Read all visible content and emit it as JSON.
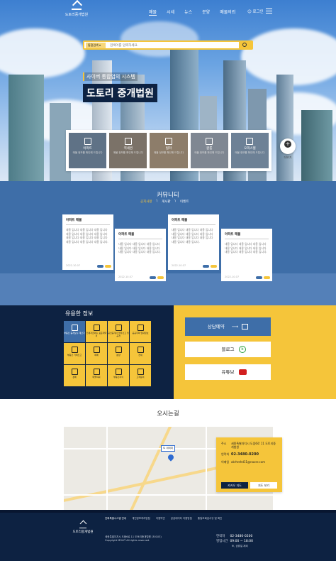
{
  "header": {
    "logo_text": "도토리중개법원",
    "menu": [
      "매물",
      "시세",
      "뉴스",
      "분양",
      "매물의뢰"
    ],
    "active_menu": "매물",
    "login": "로그인"
  },
  "search": {
    "select_label": "통합검색",
    "placeholder": "검색어를 입력하세요."
  },
  "hero": {
    "subtitle": "사이버 통합업의 시스템",
    "title": "도토리 중개법원"
  },
  "categories": [
    {
      "label": "아파트",
      "sub": "매물 정보를 확인해 드립니다"
    },
    {
      "label": "역세권",
      "sub": "매물 정보를 확인해 드립니다"
    },
    {
      "label": "빌라",
      "sub": "매물 정보를 확인해 드립니다"
    },
    {
      "label": "원룸",
      "sub": "매물 정보를 확인해 드립니다"
    },
    {
      "label": "오피스텔",
      "sub": "매물 정보를 확인해 드립니다"
    }
  ],
  "more_label": "더보기",
  "community": {
    "title": "커뮤니티",
    "tabs": [
      "공지사항",
      "게시판",
      "이벤트"
    ],
    "cards": [
      {
        "title": "아파트 매물",
        "body": "내용 입니다 내용 입니다 내용 입니다 내용 입니다 내용 입니다 내용 입니다 내용 입니다 내용 입니다 내용 입니다 내용 입니다 내용 입니다 내용 입니다.",
        "date": "2022.10.07"
      },
      {
        "title": "아파트 매물",
        "body": "내용 입니다 내용 입니다 내용 입니다 내용 입니다 내용 입니다 내용 입니다 내용 입니다 내용 입니다 내용 입니다.",
        "date": "2022.10.07"
      },
      {
        "title": "아파트 매물",
        "body": "내용 입니다 내용 입니다 내용 입니다 내용 입니다 내용 입니다 내용 입니다 내용 입니다 내용 입니다 내용 입니다 내용 입니다 내용 입니다.",
        "date": "2022.10.07"
      },
      {
        "title": "아파트 매물",
        "body": "내용 입니다 내용 입니다 내용 입니다 내용 입니다 내용 입니다 내용 입니다 내용 입니다 내용 입니다 내용 입니다.",
        "date": "2022.10.07"
      }
    ]
  },
  "info": {
    "title": "유용한 정보",
    "items": [
      "부동산 중개보수 계산기",
      "전세자금대출 표준계약서",
      "공인중개사 업무신고 및 공개",
      "공공주택 임대정보",
      "부동산 거래신고",
      "매매",
      "분양",
      "전세",
      "경매",
      "매물의뢰",
      "부동산지식",
      "고객문의"
    ]
  },
  "cta": {
    "consult": "상담예약",
    "blog": "블로그",
    "youtube": "유튜브"
  },
  "location": {
    "title": "오시는길",
    "pin_label": "도 서비치",
    "address_key": "주소",
    "address": "세종특별자치시 도움6로 11 도토리중개법원",
    "phone_key": "연락처",
    "phone": "02-3480-0200",
    "email_key": "이메일",
    "email": "akrhrehd11@naver.com",
    "btn_kakao": "카카오 지도",
    "btn_naver": "지도 보기"
  },
  "footer": {
    "logo": "도토리중개법원",
    "links": [
      "전화특별시스템 안내",
      "개인정보처리방침",
      "이용약관",
      "공공데이터 이용방침",
      "통일조회검사규 및 확인"
    ],
    "address": "세종특별자치시 도움6로 11 도토리중개법원 (30103)",
    "copyright": "Copyright MOLIT All rights reserved.",
    "contact_phone_key": "연락처",
    "contact_phone": "02-3480-0200",
    "hours_key": "영업시간",
    "hours": "09:00 ~ 18:00",
    "hours_note": "토, 공휴일 제외"
  },
  "colors": {
    "navy": "#0d2242",
    "blue": "#3e6ea8",
    "yellow": "#f5c53a"
  }
}
